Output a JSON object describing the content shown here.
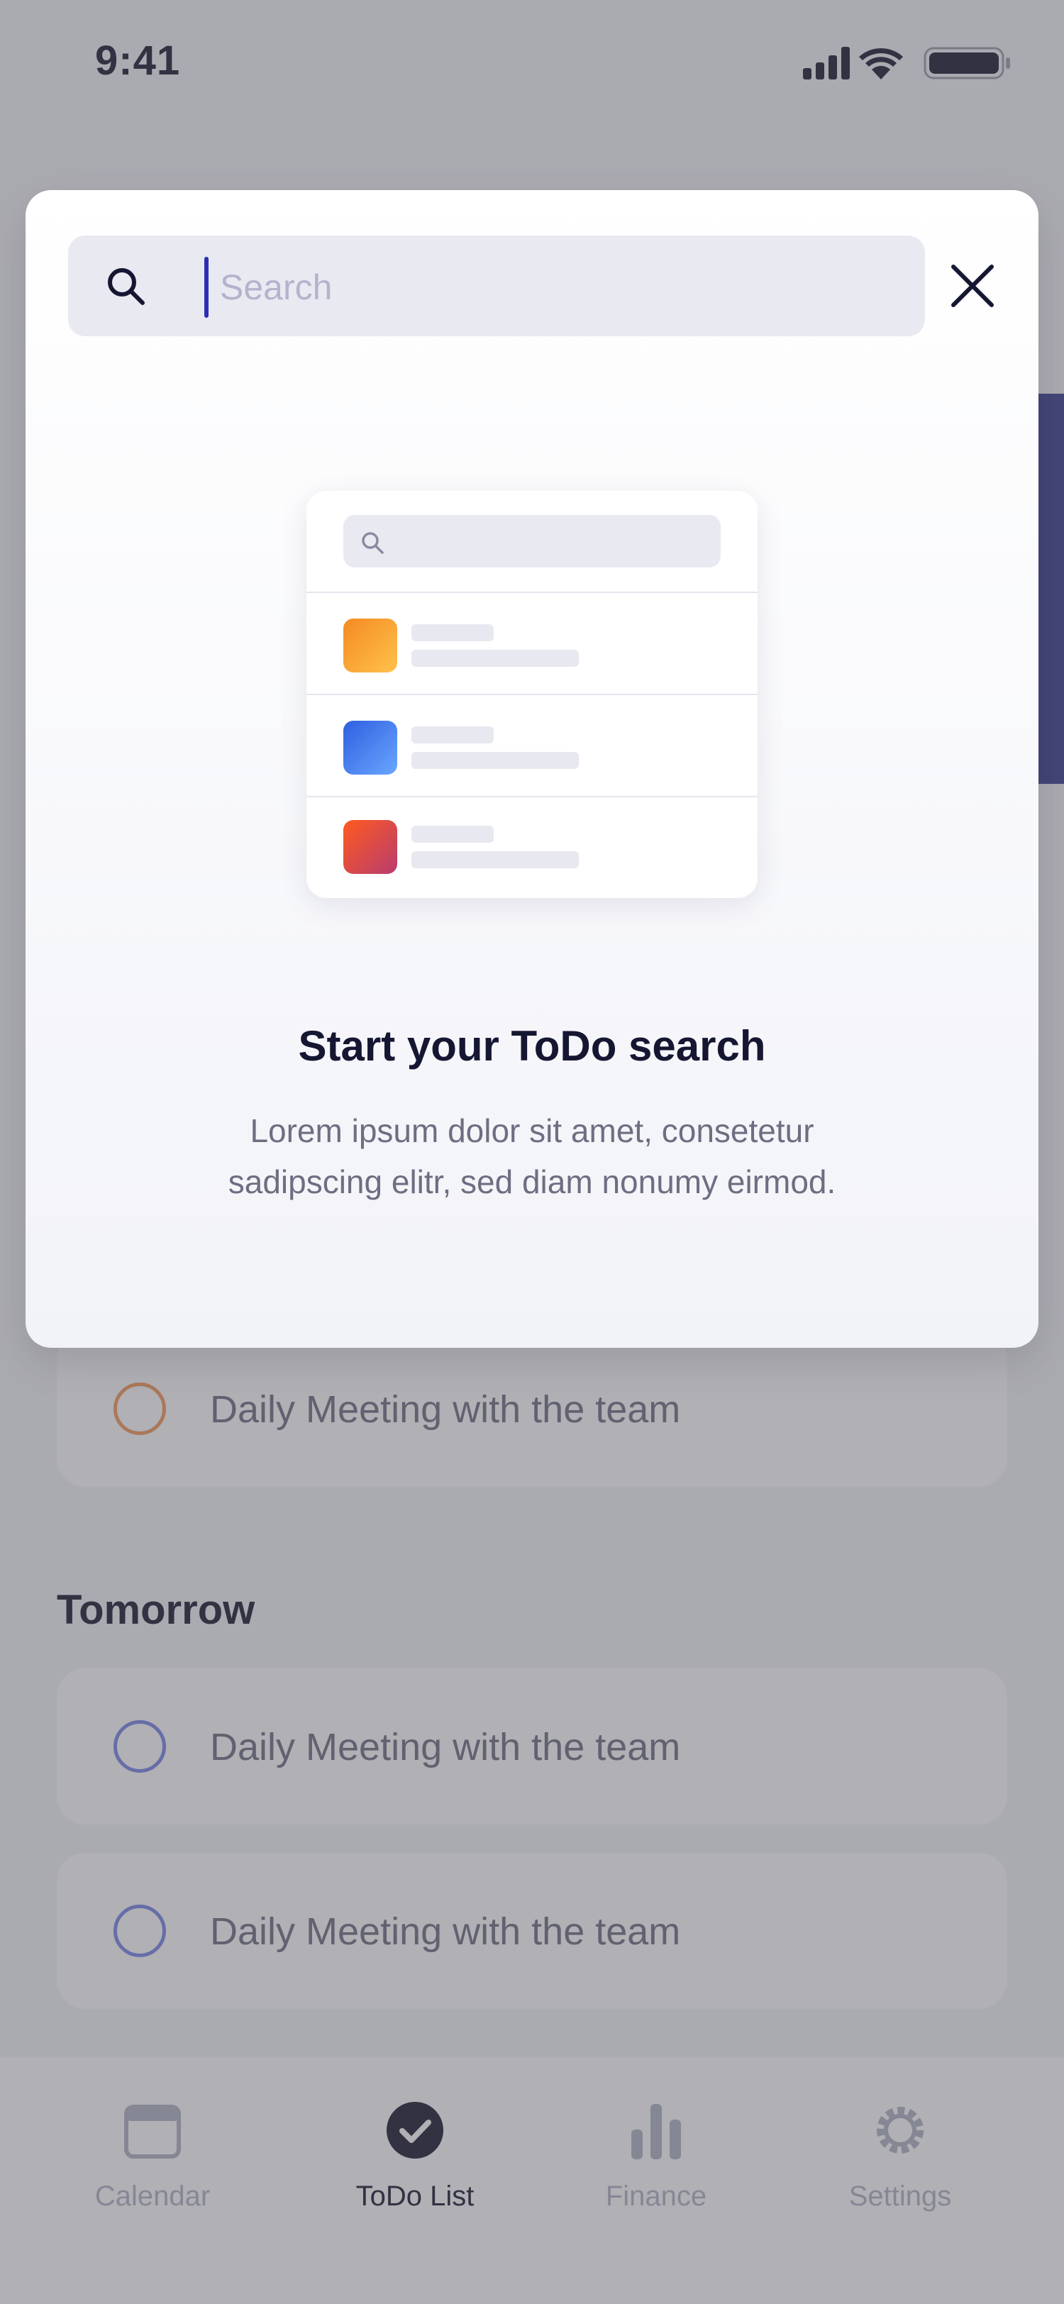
{
  "status_bar": {
    "time": "9:41"
  },
  "background": {
    "task_label": "Daily Meeting with the team",
    "section_tomorrow": "Tomorrow",
    "tabs": [
      {
        "label": "Calendar",
        "icon": "calendar-icon"
      },
      {
        "label": "ToDo List",
        "icon": "check-circle-icon",
        "active": true
      },
      {
        "label": "Finance",
        "icon": "bar-chart-icon"
      },
      {
        "label": "Settings",
        "icon": "gear-icon"
      }
    ]
  },
  "search_modal": {
    "search": {
      "placeholder": "Search",
      "value": ""
    },
    "empty_state": {
      "title": "Start your ToDo search",
      "description": "Lorem ipsum dolor sit amet, consetetur sadipscing elitr, sed diam nonumy eirmod."
    }
  },
  "colors": {
    "accent": "#2b2fb3",
    "title": "#151732",
    "placeholder": "#b2b4cc",
    "scrim": "rgba(80,80,90,0.45)"
  }
}
